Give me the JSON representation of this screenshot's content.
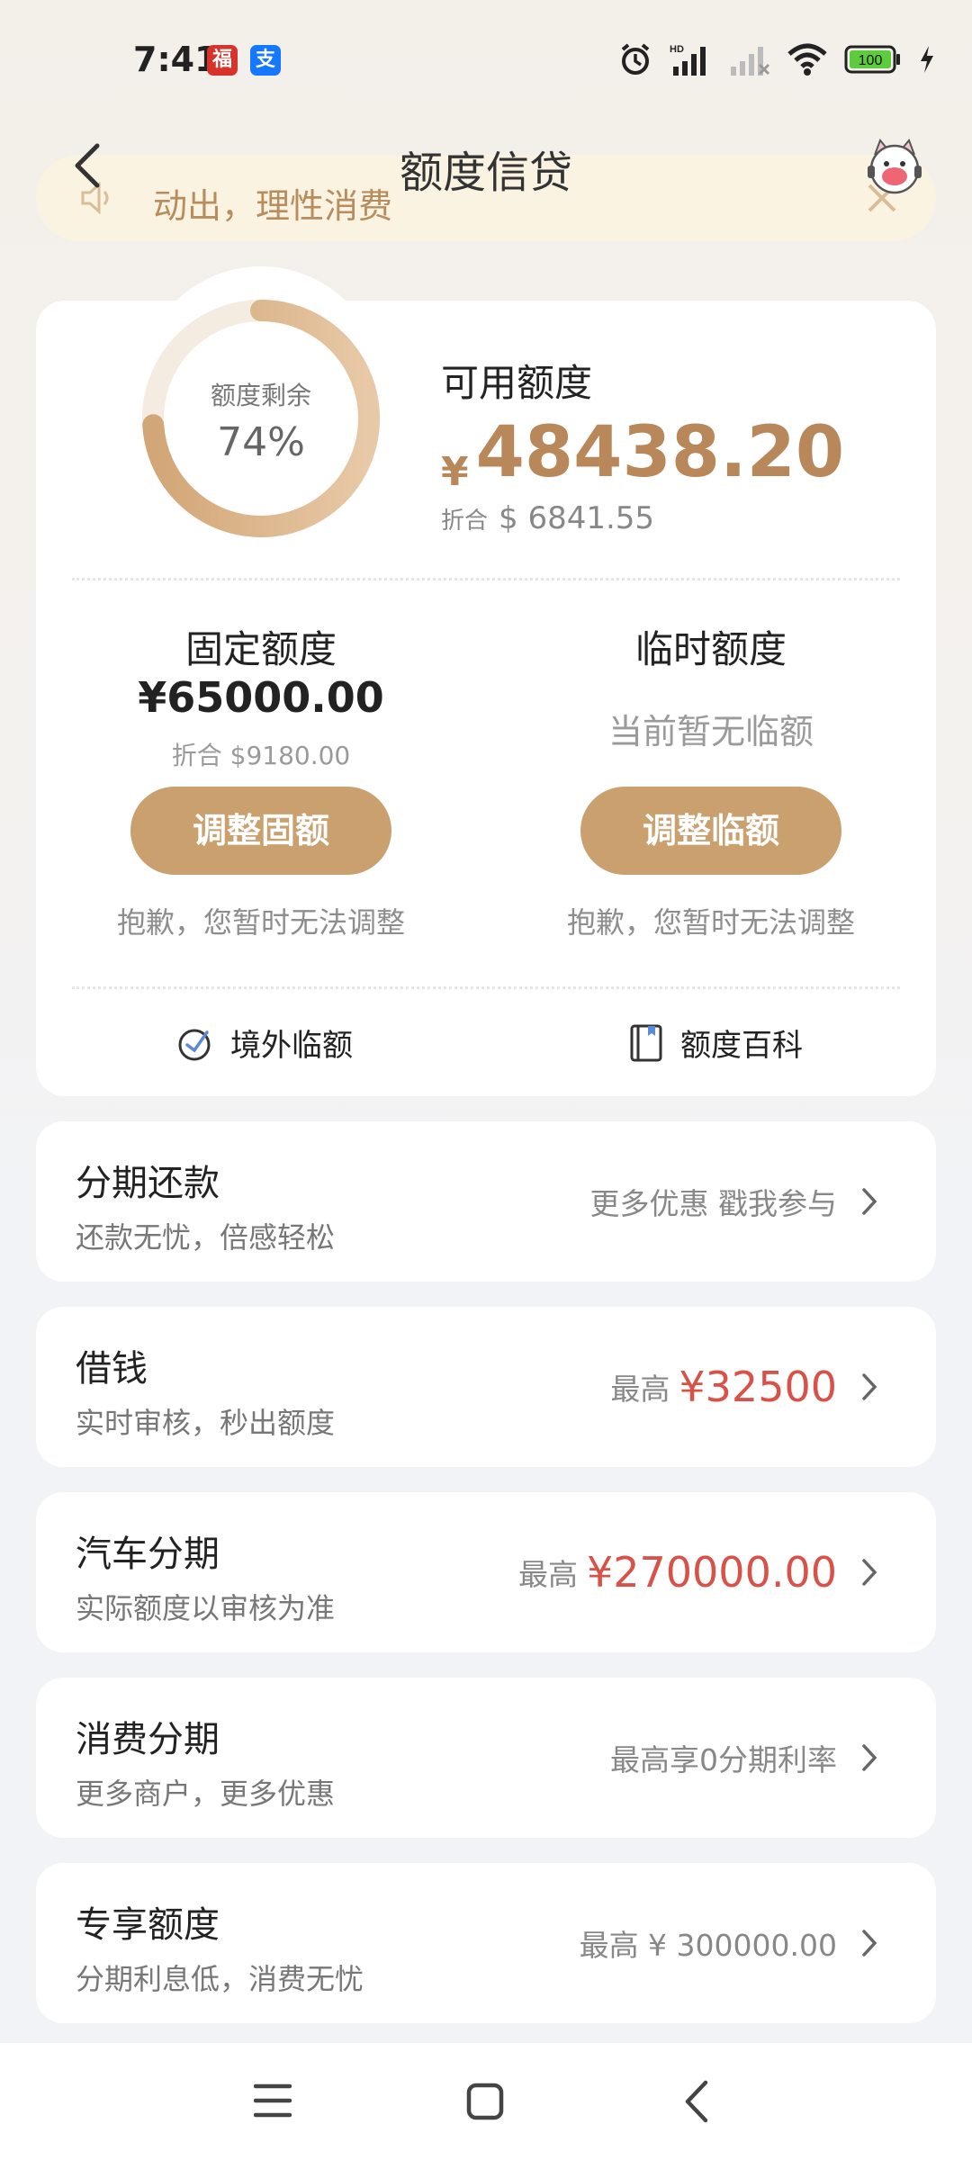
{
  "status_bar": {
    "time": "7:41",
    "battery": "100"
  },
  "header": {
    "title": "额度信贷"
  },
  "notice": {
    "text": "动出，理性消费"
  },
  "credit": {
    "ring_label": "额度剩余",
    "ring_percent": "74%",
    "ring_fraction": 0.74,
    "available_label": "可用额度",
    "available_currency": "¥",
    "available_amount": "48438.20",
    "available_usd_label": "折合",
    "available_usd": "$ 6841.55"
  },
  "fixed": {
    "title": "固定额度",
    "amount": "¥65000.00",
    "usd": "折合 $9180.00",
    "button": "调整固额",
    "note": "抱歉，您暂时无法调整"
  },
  "temporary": {
    "title": "临时额度",
    "none_text": "当前暂无临额",
    "button": "调整临额",
    "note": "抱歉，您暂时无法调整"
  },
  "links": {
    "overseas": "境外临额",
    "wiki": "额度百科"
  },
  "services": [
    {
      "title": "分期还款",
      "subtitle": "还款无忧，倍感轻松",
      "right_text": "更多优惠 戳我参与"
    },
    {
      "title": "借钱",
      "subtitle": "实时审核，秒出额度",
      "right_prefix": "最高",
      "right_amount": "¥32500"
    },
    {
      "title": "汽车分期",
      "subtitle": "实际额度以审核为准",
      "right_prefix": "最高",
      "right_amount": "¥270000.00"
    },
    {
      "title": "消费分期",
      "subtitle": "更多商户，更多优惠",
      "right_text": "最高享0分期利率"
    },
    {
      "title": "专享额度",
      "subtitle": "分期利息低，消费无忧",
      "right_text": "最高 ¥ 300000.00"
    }
  ],
  "colors": {
    "gold": "#c9a06e",
    "gold_text": "#b8885a",
    "red": "#d9524a",
    "notice_bg": "#fbf3e2"
  },
  "icons": [
    "back-icon",
    "mascot-icon",
    "speaker-icon",
    "close-icon",
    "overseas-icon",
    "book-icon",
    "chevron-right-icon",
    "menu-icon",
    "home-icon",
    "nav-back-icon"
  ]
}
